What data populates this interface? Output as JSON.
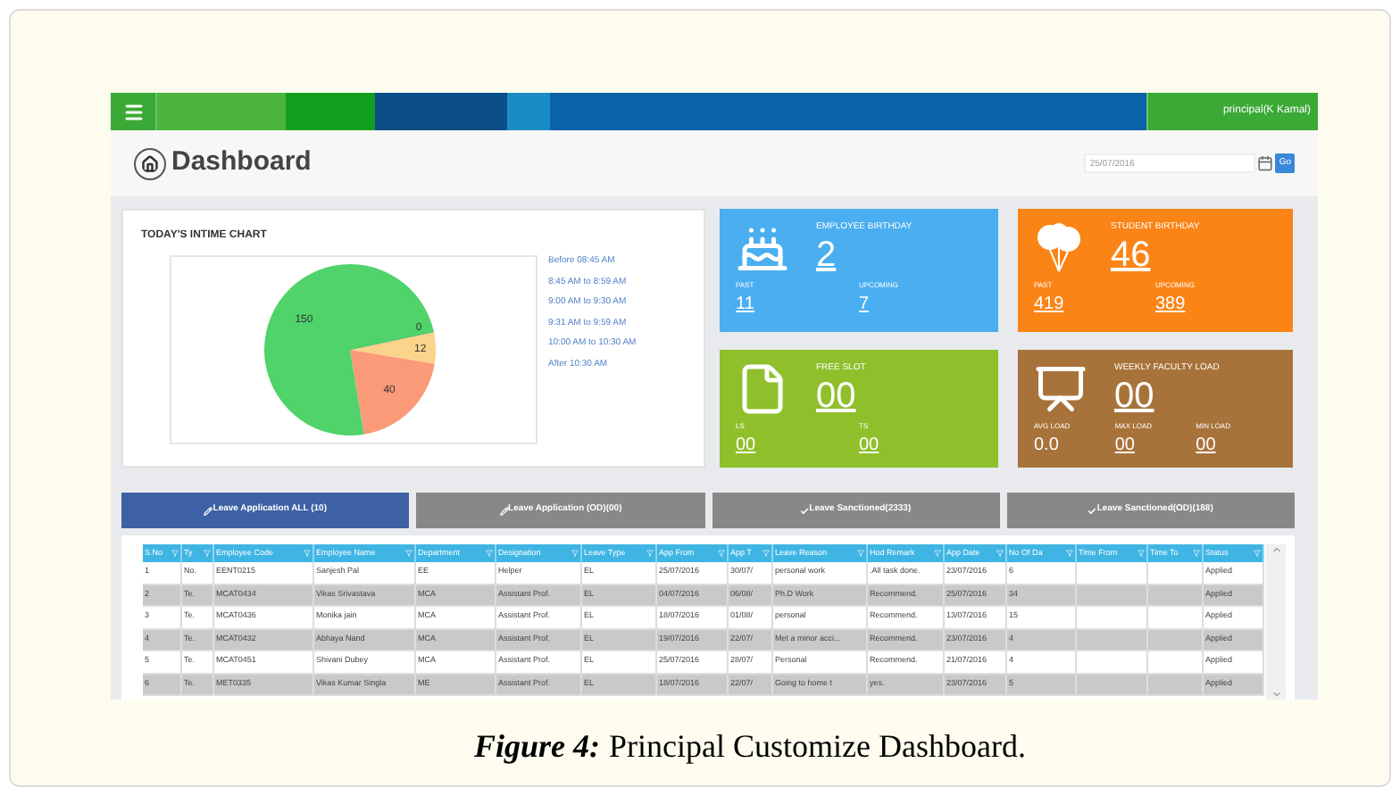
{
  "top_bar": {
    "user": "principal(K Kamal)"
  },
  "header": {
    "title": "Dashboard",
    "date_field": {
      "value": "25/07/2016"
    },
    "go_button": "Go"
  },
  "intime_chart": {
    "title": "TODAY'S INTIME CHART",
    "chart_data": {
      "type": "pie",
      "values": [
        0,
        12,
        40,
        150
      ],
      "value_labels": [
        "0",
        "12",
        "40",
        "150"
      ]
    },
    "legend": [
      "Before 08:45 AM",
      "8:45 AM to 8:59 AM",
      "9:00 AM to 9:30 AM",
      "9:31 AM to 9:59 AM",
      "10:00 AM to 10:30 AM",
      "After 10:30 AM"
    ]
  },
  "cards": [
    {
      "kind": "cake",
      "title": "EMPLOYEE BIRTHDAY",
      "count": "2",
      "color": "#4aaef0",
      "stats": [
        {
          "label": "PAST",
          "value": "11",
          "link": true
        },
        {
          "label": "UPCOMING",
          "value": "7",
          "link": true
        }
      ]
    },
    {
      "kind": "balloons",
      "title": "STUDENT BIRTHDAY",
      "count": "46",
      "color": "#fb8417",
      "stats": [
        {
          "label": "PAST",
          "value": "419",
          "link": true
        },
        {
          "label": "UPCOMING",
          "value": "389",
          "link": true
        }
      ]
    },
    {
      "kind": "document",
      "title": "FREE SLOT",
      "count": "00",
      "color": "#8fc02c",
      "stats": [
        {
          "label": "LS",
          "value": "00",
          "link": true
        },
        {
          "label": "TS",
          "value": "00",
          "link": true
        }
      ]
    },
    {
      "kind": "teacher",
      "title": "WEEKLY FACULTY LOAD",
      "count": "00",
      "color": "#a8733a",
      "stats": [
        {
          "label": "AVG LOAD",
          "value": "0.0",
          "link": false
        },
        {
          "label": "MAX LOAD",
          "value": "00",
          "link": true
        },
        {
          "label": "MIN LOAD",
          "value": "00",
          "link": true
        }
      ]
    }
  ],
  "tabs": [
    {
      "label": "Leave Application ALL (10)",
      "kind": "pencil",
      "selected": true
    },
    {
      "label": "Leave Application (OD)(00)",
      "kind": "pencil",
      "selected": false
    },
    {
      "label": "Leave Sanctioned(2333)",
      "kind": "check",
      "selected": false
    },
    {
      "label": "Leave Sanctioned(OD)(188)",
      "kind": "check",
      "selected": false
    }
  ],
  "table": {
    "columns": [
      "S.No",
      "Ty",
      "Employee Code",
      "Employee Name",
      "Department",
      "Designation",
      "Leave Type",
      "App From",
      "App T",
      "Leave Reason",
      "Hod Remark",
      "App Date",
      "No Of Da",
      "Time From",
      "Time To",
      "Status"
    ],
    "rows": [
      [
        "1",
        "No.",
        "EENT0215",
        "Sanjesh Pal",
        "EE",
        "Helper",
        "EL",
        "25/07/2016",
        "30/07/",
        "personal work",
        ".All task done.",
        "23/07/2016",
        "6",
        "",
        "",
        "Applied"
      ],
      [
        "2",
        "Te.",
        "MCAT0434",
        "Vikas Srivastava",
        "MCA",
        "Assistant Prof.",
        "EL",
        "04/07/2016",
        "06/08/",
        "Ph.D Work",
        "Recommend.",
        "25/07/2016",
        "34",
        "",
        "",
        "Applied"
      ],
      [
        "3",
        "Te.",
        "MCAT0436",
        "Monika jain",
        "MCA",
        "Assistant Prof.",
        "EL",
        "18/07/2016",
        "01/08/",
        "personal",
        "Recommend.",
        "13/07/2016",
        "15",
        "",
        "",
        "Applied"
      ],
      [
        "4",
        "Te.",
        "MCAT0432",
        "Abhaya Nand",
        "MCA",
        "Assistant Prof.",
        "EL",
        "19/07/2016",
        "22/07/",
        "Met a minor acci...",
        "Recommend.",
        "23/07/2016",
        "4",
        "",
        "",
        "Applied"
      ],
      [
        "5",
        "Te.",
        "MCAT0451",
        "Shivani Dubey",
        "MCA",
        "Assistant Prof.",
        "EL",
        "25/07/2016",
        "28/07/",
        "Personal",
        "Recommend.",
        "21/07/2016",
        "4",
        "",
        "",
        "Applied"
      ],
      [
        "6",
        "Te.",
        "MET0335",
        "Vikas Kumar Singla",
        "ME",
        "Assistant Prof.",
        "EL",
        "18/07/2016",
        "22/07/",
        "Going to home t",
        "yes.",
        "23/07/2016",
        "5",
        "",
        "",
        "Applied"
      ]
    ]
  },
  "caption": {
    "label": "Figure 4:",
    "text": "Principal Customize Dashboard."
  }
}
